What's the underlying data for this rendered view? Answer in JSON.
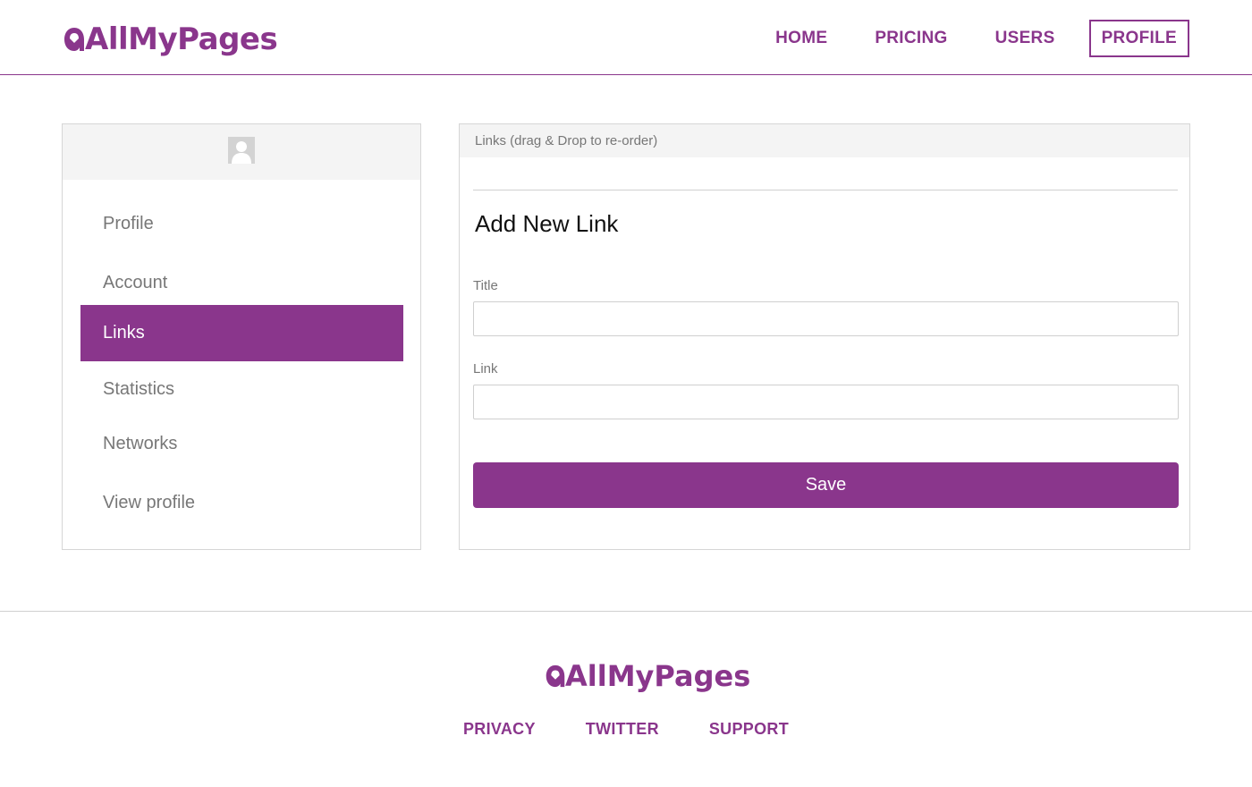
{
  "brand": {
    "name": "AllMyPages",
    "color": "#8a368c"
  },
  "nav": {
    "items": [
      {
        "label": "HOME",
        "active": false
      },
      {
        "label": "PRICING",
        "active": false
      },
      {
        "label": "USERS",
        "active": false
      },
      {
        "label": "PROFILE",
        "active": true
      }
    ]
  },
  "sidebar": {
    "avatar_icon": "user-avatar-icon",
    "items": [
      {
        "label": "Profile",
        "active": false
      },
      {
        "label": "Account",
        "active": false
      },
      {
        "label": "Links",
        "active": true
      },
      {
        "label": "Statistics",
        "active": false
      },
      {
        "label": "Networks",
        "active": false
      },
      {
        "label": "View profile",
        "active": false
      }
    ]
  },
  "main": {
    "header": "Links (drag & Drop to re-order)",
    "form_title": "Add New Link",
    "fields": {
      "title": {
        "label": "Title",
        "value": "",
        "placeholder": ""
      },
      "link": {
        "label": "Link",
        "value": "",
        "placeholder": ""
      }
    },
    "save_label": "Save"
  },
  "footer": {
    "links": [
      "PRIVACY",
      "TWITTER",
      "SUPPORT"
    ]
  }
}
